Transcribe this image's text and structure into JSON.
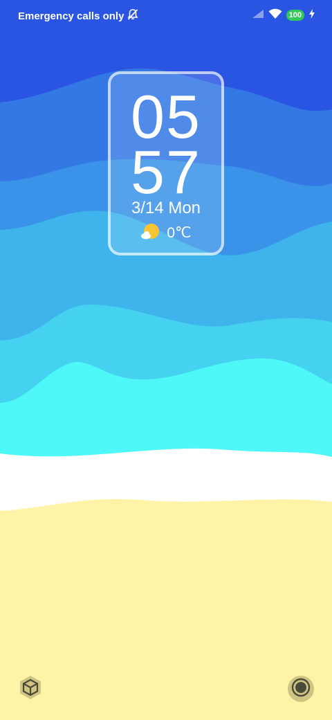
{
  "status_bar": {
    "carrier_text": "Emergency calls only",
    "battery_level": "100",
    "battery_color": "#34c759",
    "icons": [
      "notifications-muted-icon",
      "cellular-signal-icon",
      "wifi-icon",
      "charging-bolt-icon"
    ]
  },
  "clock": {
    "hour": "05",
    "minute": "57",
    "date": "3/14 Mon"
  },
  "weather": {
    "icon": "partly-cloudy-sun-icon",
    "temperature": "0℃"
  },
  "shortcuts": {
    "left_icon": "3d-cube-icon",
    "right_icon": "camera-shutter-icon"
  },
  "colors": {
    "wave_1": "#2a55e2",
    "wave_2": "#3478e6",
    "wave_3": "#3a93e8",
    "wave_4": "#3fb4ec",
    "wave_5": "#45d2f0",
    "wave_6": "#4ff8f8",
    "foam": "#ffffff",
    "sand": "#fff3a8"
  }
}
